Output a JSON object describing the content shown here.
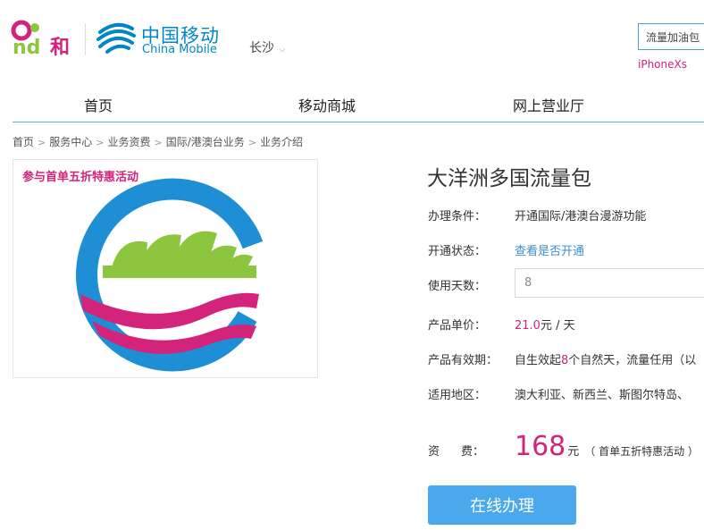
{
  "header": {
    "and_logo_text": "and和",
    "brand_cn": "中国移动",
    "brand_en": "China Mobile",
    "city": "长沙",
    "search_value": "流量加油包",
    "hot_link": "iPhoneXs"
  },
  "nav": {
    "items": [
      "首页",
      "移动商城",
      "网上营业厅"
    ]
  },
  "breadcrumb": [
    "首页",
    "服务中心",
    "业务资费",
    "国际/港澳台业务",
    "业务介绍"
  ],
  "product": {
    "promo_tag": "参与首单五折特惠活动",
    "title": "大洋洲多国流量包",
    "condition_label": "办理条件：",
    "condition_value": "开通国际/港澳台漫游功能",
    "status_label": "开通状态：",
    "status_link": "查看是否开通",
    "days_label": "使用天数：",
    "days_value": "8",
    "price_label": "产品单价：",
    "price_amount": "21.0",
    "price_unit": "元 / 天",
    "validity_label": "产品有效期：",
    "validity_prefix": "自生效起",
    "validity_days": "8",
    "validity_suffix": "个自然天，流量任用（以",
    "region_label": "适用地区：",
    "region_value": "澳大利亚、新西兰、斯图尔特岛、",
    "fee_label_1": "资",
    "fee_label_2": "费：",
    "fee_amount": "168",
    "fee_unit": "元",
    "fee_note": "（ 首单五折特惠活动 ）",
    "apply_button": "在线办理"
  },
  "colors": {
    "brand_blue": "#0087c8",
    "accent_pink": "#d4237a",
    "link_blue": "#3a8fd0",
    "button_blue": "#4aa8ec",
    "logo_green": "#8cc63f"
  }
}
